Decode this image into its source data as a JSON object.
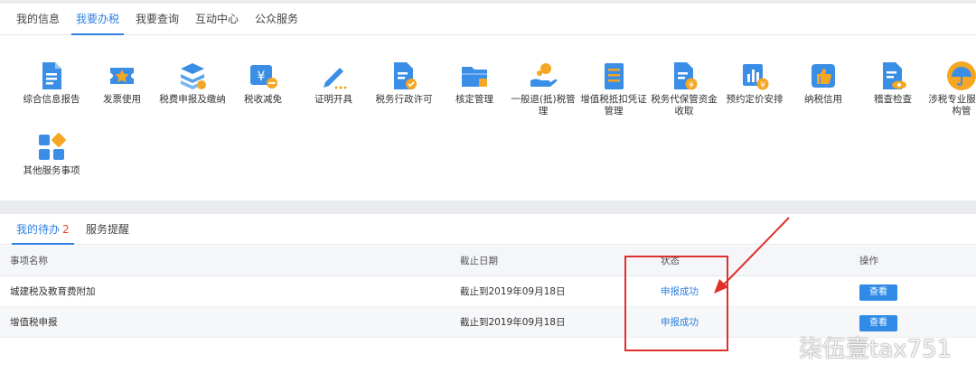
{
  "top_tabs": [
    "我的信息",
    "我要办税",
    "我要查询",
    "互动中心",
    "公众服务"
  ],
  "active_top_tab": 1,
  "services": [
    {
      "label": "综合信息报告",
      "icon": "document-icon"
    },
    {
      "label": "发票使用",
      "icon": "invoice-star-icon"
    },
    {
      "label": "税费申报及缴纳",
      "icon": "layers-icon"
    },
    {
      "label": "税收减免",
      "icon": "yuan-minus-icon"
    },
    {
      "label": "证明开具",
      "icon": "pen-icon"
    },
    {
      "label": "税务行政许可",
      "icon": "document-check-icon"
    },
    {
      "label": "核定管理",
      "icon": "folder-icon"
    },
    {
      "label": "一般退(抵)税管理",
      "icon": "hand-coin-icon"
    },
    {
      "label": "增值税抵扣凭证管理",
      "icon": "ledger-icon"
    },
    {
      "label": "税务代保管资金收取",
      "icon": "document-yuan-icon"
    },
    {
      "label": "预约定价安排",
      "icon": "chart-yuan-icon"
    },
    {
      "label": "纳税信用",
      "icon": "thumbs-up-icon"
    },
    {
      "label": "稽查检查",
      "icon": "document-eye-icon"
    },
    {
      "label": "涉税专业服务机构管",
      "icon": "umbrella-icon"
    },
    {
      "label": "其他服务事项",
      "icon": "grid-icon"
    }
  ],
  "bottom_tabs": {
    "todo_label": "我的待办",
    "todo_count": "2",
    "reminder_label": "服务提醒"
  },
  "table": {
    "headers": [
      "事项名称",
      "截止日期",
      "状态",
      "操作"
    ],
    "rows": [
      {
        "name": "城建税及教育费附加",
        "deadline": "截止到2019年09月18日",
        "status": "申报成功",
        "action": "查看"
      },
      {
        "name": "增值税申报",
        "deadline": "截止到2019年09月18日",
        "status": "申报成功",
        "action": "查看"
      }
    ]
  },
  "watermark": "柒伍壹tax751",
  "colors": {
    "accent": "#2f7fe0",
    "annotation": "#e0302c",
    "count": "#e8452c"
  }
}
